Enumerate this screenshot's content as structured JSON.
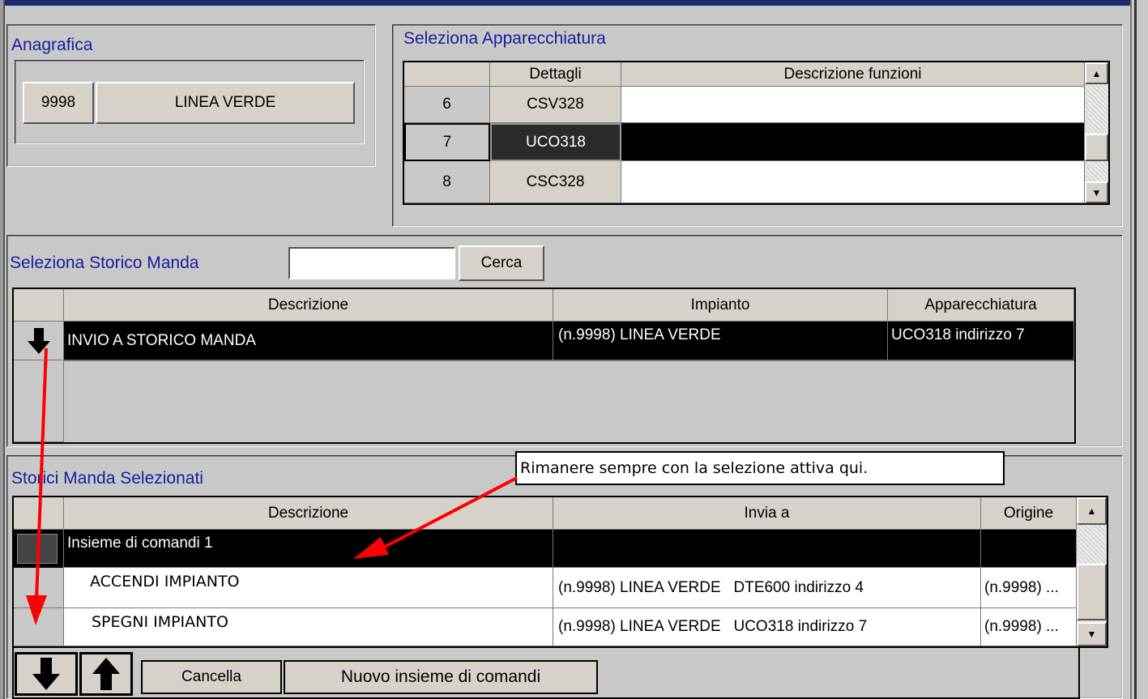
{
  "anagrafica": {
    "title": "Anagrafica",
    "code": "9998",
    "name": "LINEA VERDE"
  },
  "apparecchiatura": {
    "title": "Seleziona Apparecchiatura",
    "headers": {
      "dettagli": "Dettagli",
      "descrizione": "Descrizione funzioni"
    },
    "rows": [
      {
        "num": "6",
        "code": "CSV328",
        "desc": ""
      },
      {
        "num": "7",
        "code": "UCO318",
        "desc": ""
      },
      {
        "num": "8",
        "code": "CSC328",
        "desc": ""
      }
    ],
    "selected_row": "7"
  },
  "storico": {
    "title": "Seleziona Storico Manda",
    "search_value": "",
    "search_button": "Cerca",
    "headers": {
      "descrizione": "Descrizione",
      "impianto": "Impianto",
      "apparecchiatura": "Apparecchiatura"
    },
    "rows": [
      {
        "descrizione": "INVIO A STORICO MANDA",
        "impianto": "(n.9998) LINEA VERDE",
        "apparecchiatura": "UCO318 indirizzo 7"
      }
    ]
  },
  "selezionati": {
    "title": "Storici Manda Selezionati",
    "headers": {
      "descrizione": "Descrizione",
      "invia": "Invia a",
      "origine": "Origine"
    },
    "group_row": {
      "descrizione": "Insieme di comandi 1"
    },
    "rows": [
      {
        "descrizione": "ACCENDI IMPIANTO",
        "invia": "(n.9998) LINEA VERDE   DTE600 indirizzo 4",
        "origine": "(n.9998) ..."
      },
      {
        "descrizione": "SPEGNI IMPIANTO",
        "invia": "(n.9998) LINEA VERDE   UCO318 indirizzo 7",
        "origine": "(n.9998) ..."
      }
    ],
    "buttons": {
      "cancella": "Cancella",
      "nuovo": "Nuovo insieme di comandi"
    }
  },
  "annotation": {
    "text": "Rimanere sempre con la selezione attiva qui.",
    "arrow_color": "#ff0000"
  },
  "colors": {
    "title_blue": "#1b1b9e",
    "selection": "#000000",
    "annotation_red": "#ff0000"
  }
}
